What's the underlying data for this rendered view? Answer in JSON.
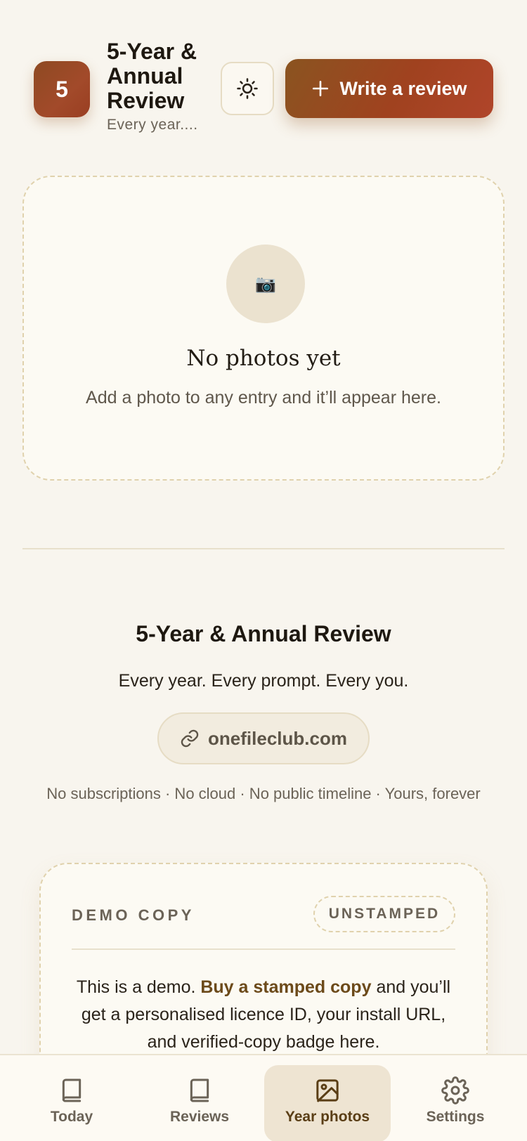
{
  "header": {
    "logo_text": "5",
    "title": "5-Year & Annual Review",
    "subtitle": "Every year....",
    "theme_icon": "sun-icon",
    "write_button_label": "Write a review",
    "write_button_icon": "plus-icon"
  },
  "empty_state": {
    "icon": "camera-icon",
    "icon_glyph": "📷",
    "title": "No photos yet",
    "description": "Add a photo to any entry and it’ll appear here."
  },
  "footer": {
    "brand_title": "5-Year & Annual Review",
    "tagline": "Every year. Every prompt. Every you.",
    "site_link": "onefileclub.com",
    "fine_print": "No subscriptions · No cloud · No public timeline · Yours, forever"
  },
  "demo_card": {
    "label": "DEMO COPY",
    "badge": "UNSTAMPED",
    "text_before": "This is a demo. ",
    "link_text": "Buy a stamped copy",
    "text_after": " and you’ll get a personalised licence ID, your install URL, and verified-copy badge here."
  },
  "nav": {
    "items": [
      {
        "label": "Today",
        "icon": "book-icon",
        "active": false
      },
      {
        "label": "Reviews",
        "icon": "book-icon",
        "active": false
      },
      {
        "label": "Year photos",
        "icon": "image-icon",
        "active": true
      },
      {
        "label": "Settings",
        "icon": "gear-icon",
        "active": false
      }
    ]
  },
  "colors": {
    "background": "#f8f5ee",
    "accent": "#a0421f",
    "active_nav_bg": "#eee4d2"
  }
}
